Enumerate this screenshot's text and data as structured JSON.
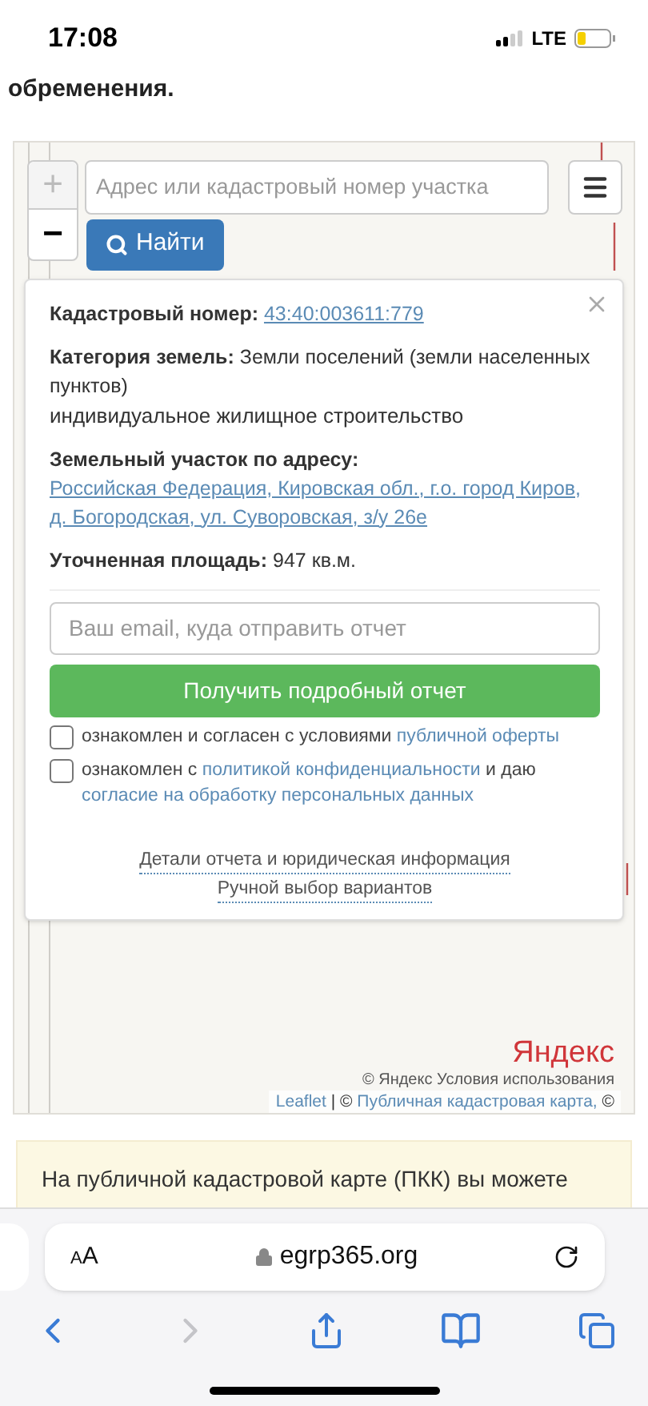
{
  "status_bar": {
    "time": "17:08",
    "network": "LTE"
  },
  "page_text": "обременения.",
  "map": {
    "zoom_in": "+",
    "zoom_out": "−",
    "search": {
      "placeholder": "Адрес или кадастровый номер участка"
    },
    "find_button": "Найти",
    "popup": {
      "fields": [
        {
          "label": "Кадастровый номер:",
          "value": "43:40:003611:779",
          "kind": "link"
        },
        {
          "label": "Категория земель:",
          "value": "Земли поселений (земли населенных пунктов)",
          "kind": "text",
          "note": "индивидуальное жилищное строительство"
        },
        {
          "label": "Земельный участок по адресу:",
          "value": "Российская Федерация, Кировская обл., г.о. город Киров, д. Богородская, ул. Суворовская, з/у 26е",
          "kind": "link"
        },
        {
          "label": "Уточненная площадь:",
          "value": "947 кв.м.",
          "kind": "text"
        }
      ],
      "email": {
        "placeholder": "Ваш email, куда отправить отчет"
      },
      "report_button": "Получить подробный отчет",
      "consents": [
        {
          "checked": false,
          "parts": [
            {
              "kind": "text",
              "text": "ознакомлен и согласен с условиями"
            },
            {
              "kind": "link",
              "text": "публичной оферты"
            }
          ]
        },
        {
          "checked": false,
          "parts": [
            {
              "kind": "text",
              "text": "ознакомлен с"
            },
            {
              "kind": "link",
              "text": "политикой конфиденциальности"
            },
            {
              "kind": "text",
              "text": "и даю"
            },
            {
              "kind": "link",
              "text": "согласие на обработку персональных данных"
            }
          ]
        }
      ],
      "links": [
        "Детали отчета и юридическая информация",
        "Ручной выбор вариантов"
      ]
    },
    "logo": "Яндекс",
    "copyright": "© Яндекс Условия использования",
    "attribution": [
      {
        "kind": "link",
        "text": "Leaflet"
      },
      {
        "kind": "text",
        "text": "| ©"
      },
      {
        "kind": "link",
        "text": "Публичная кадастровая карта,"
      },
      {
        "kind": "text",
        "text": "©"
      }
    ]
  },
  "notice": "На публичной кадастровой карте (ПКК) вы можете",
  "browser": {
    "text_size": "AA",
    "url": "egrp365.org",
    "forward_disabled": true
  }
}
